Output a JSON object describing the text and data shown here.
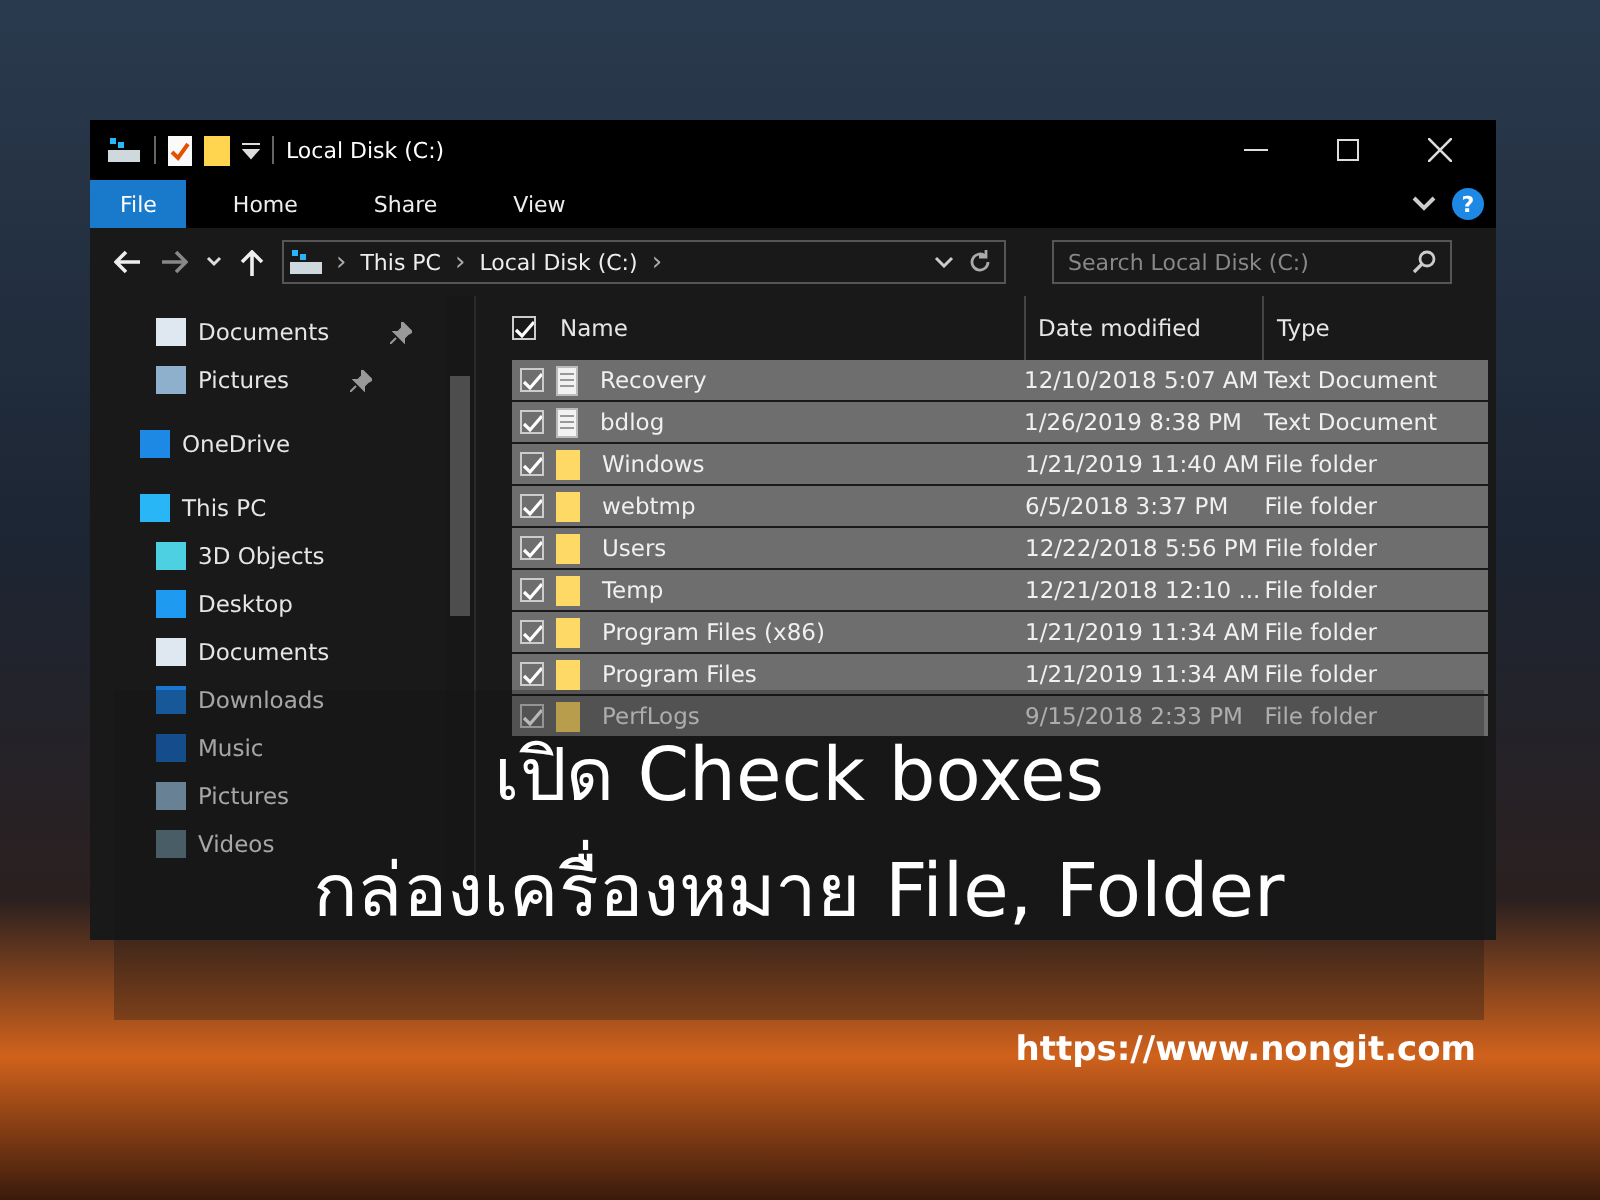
{
  "window": {
    "title": "Local Disk (C:)"
  },
  "ribbon_tabs": [
    {
      "label": "File",
      "selected": true
    },
    {
      "label": "Home",
      "selected": false
    },
    {
      "label": "Share",
      "selected": false
    },
    {
      "label": "View",
      "selected": false
    }
  ],
  "address": {
    "crumbs": [
      "This PC",
      "Local Disk (C:)"
    ]
  },
  "search": {
    "placeholder": "Search Local Disk (C:)"
  },
  "help": "?",
  "crumb_separator": "›",
  "sidebar": {
    "items": [
      {
        "label": "Documents",
        "kind": "docs",
        "pinned": true
      },
      {
        "label": "Pictures",
        "kind": "pics",
        "pinned": true
      },
      {
        "label": "OneDrive",
        "kind": "cloud",
        "pinned": false
      },
      {
        "label": "This PC",
        "kind": "pc",
        "pinned": false,
        "children": [
          {
            "label": "3D Objects",
            "kind": "cube",
            "pinned": false
          },
          {
            "label": "Desktop",
            "kind": "desktop",
            "pinned": false
          },
          {
            "label": "Documents",
            "kind": "docs",
            "pinned": false
          },
          {
            "label": "Downloads",
            "kind": "down",
            "pinned": false
          },
          {
            "label": "Music",
            "kind": "music",
            "pinned": false
          },
          {
            "label": "Pictures",
            "kind": "pics",
            "pinned": false
          },
          {
            "label": "Videos",
            "kind": "video",
            "pinned": false
          }
        ]
      }
    ]
  },
  "table": {
    "all_checked": true,
    "columns": [
      "Name",
      "Date modified",
      "Type"
    ],
    "rows": [
      {
        "name": "Recovery",
        "kind": "file",
        "date": "12/10/2018 5:07 AM",
        "type": "Text Document",
        "checked": true,
        "selected": true
      },
      {
        "name": "bdlog",
        "kind": "file",
        "date": "1/26/2019 8:38 PM",
        "type": "Text Document",
        "checked": true,
        "selected": true
      },
      {
        "name": "Windows",
        "kind": "folder",
        "date": "1/21/2019 11:40 AM",
        "type": "File folder",
        "checked": true,
        "selected": true
      },
      {
        "name": "webtmp",
        "kind": "folder",
        "date": "6/5/2018 3:37 PM",
        "type": "File folder",
        "checked": true,
        "selected": true
      },
      {
        "name": "Users",
        "kind": "folder",
        "date": "12/22/2018 5:56 PM",
        "type": "File folder",
        "checked": true,
        "selected": true
      },
      {
        "name": "Temp",
        "kind": "folder",
        "date": "12/21/2018 12:10 ...",
        "type": "File folder",
        "checked": true,
        "selected": true
      },
      {
        "name": "Program Files (x86)",
        "kind": "folder",
        "date": "1/21/2019 11:34 AM",
        "type": "File folder",
        "checked": true,
        "selected": true
      },
      {
        "name": "Program Files",
        "kind": "folder",
        "date": "1/21/2019 11:34 AM",
        "type": "File folder",
        "checked": true,
        "selected": true
      },
      {
        "name": "PerfLogs",
        "kind": "folder",
        "date": "9/15/2018 2:33 PM",
        "type": "File folder",
        "checked": true,
        "selected": true
      }
    ]
  },
  "banner": {
    "lines": [
      "เปิด Check boxes",
      "กล่องเครื่องหมาย File, Folder"
    ]
  },
  "url": "https://www.nongit.com"
}
